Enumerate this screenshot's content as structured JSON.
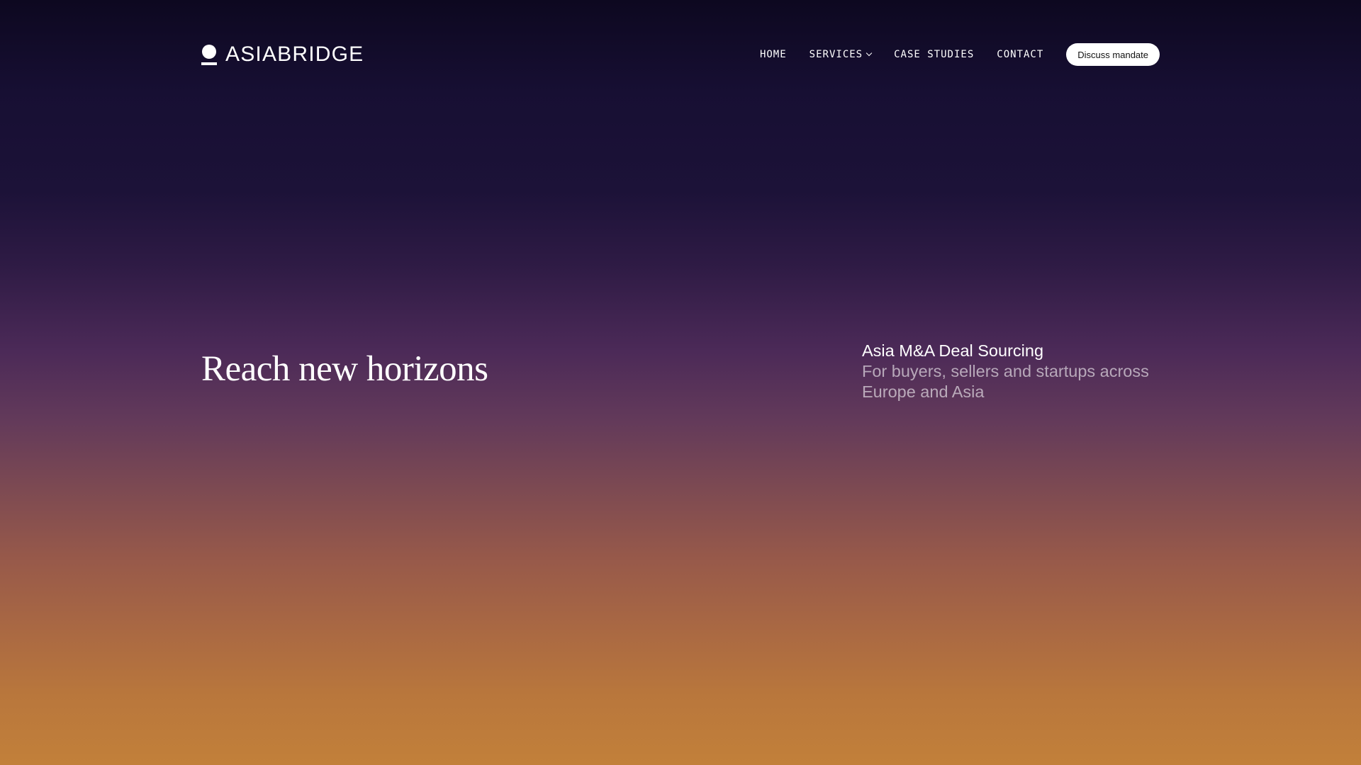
{
  "brand": {
    "name": "ASIABRIDGE",
    "logo_icon": "asiabridge-logo-mark"
  },
  "nav": {
    "items": [
      {
        "label": "HOME"
      },
      {
        "label": "SERVICES",
        "icon": "chevron-down-icon"
      },
      {
        "label": "CASE STUDIES"
      },
      {
        "label": "CONTACT"
      }
    ],
    "cta_label": "Discuss mandate"
  },
  "hero": {
    "title": "Reach new horizons",
    "side_heading": "Asia M&A Deal Sourcing",
    "side_text": "For buyers, sellers and startups across Europe and Asia"
  },
  "colors": {
    "gradient_top": "#0d0820",
    "gradient_mid": "#4c2a58",
    "gradient_bottom": "#c2803a",
    "cta_background": "#ffffff",
    "cta_text": "#111111"
  }
}
